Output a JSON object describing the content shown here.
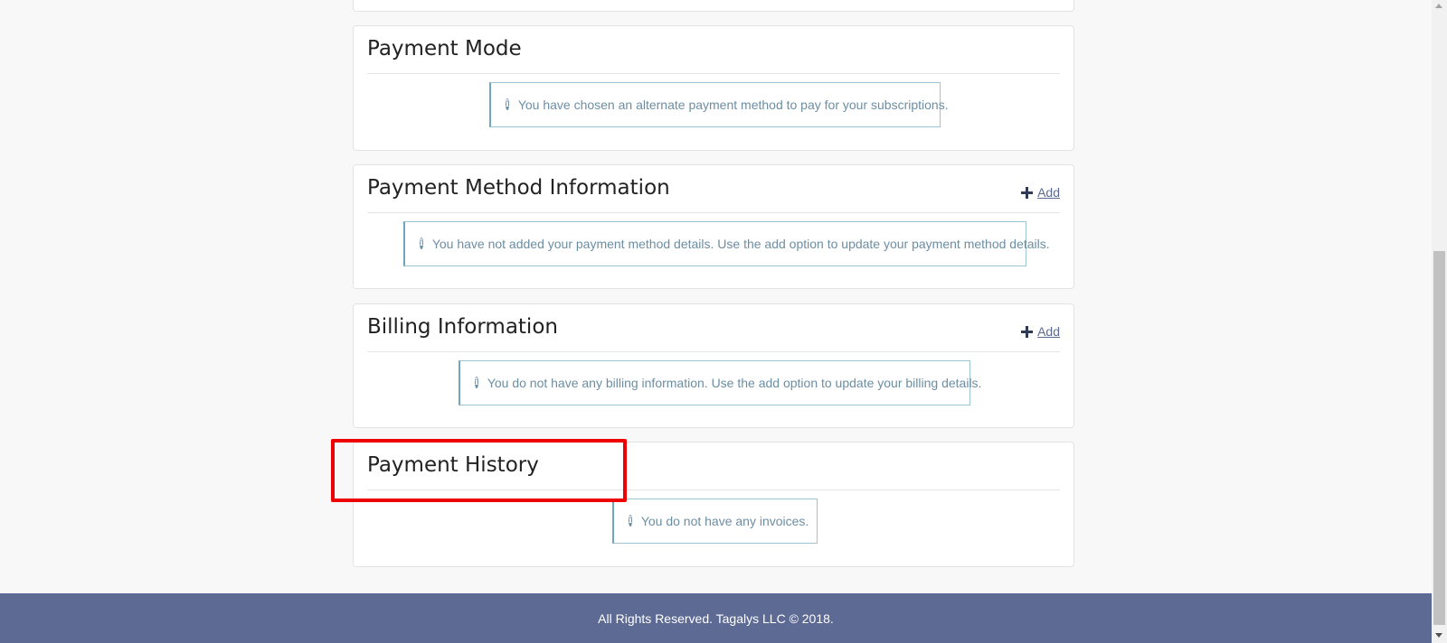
{
  "sections": {
    "payment_mode": {
      "title": "Payment Mode",
      "message": "You have chosen an alternate payment method to pay for your subscriptions."
    },
    "payment_method": {
      "title": "Payment Method Information",
      "add_label": "Add",
      "message": "You have not added your payment method details. Use the add option to update your payment method details."
    },
    "billing": {
      "title": "Billing Information",
      "add_label": "Add",
      "message": "You do not have any billing information. Use the add option to update your billing details."
    },
    "payment_history": {
      "title": "Payment History",
      "message": "You do not have any invoices."
    }
  },
  "footer": {
    "text": "All Rights Reserved. Tagalys LLC © 2018."
  },
  "icons": {
    "info": "info-circle-icon",
    "add": "plus-icon"
  },
  "colors": {
    "footer_bg": "#5d6a94",
    "info_text": "#6c8ea3",
    "info_border": "#9ec3d2",
    "highlight": "#ee0000"
  }
}
